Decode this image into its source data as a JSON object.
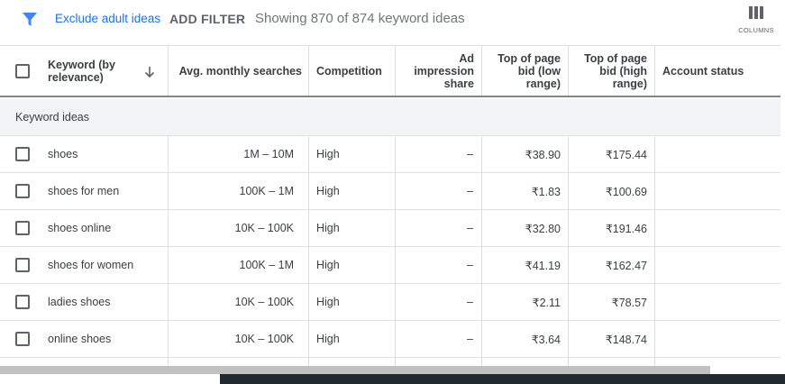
{
  "toolbar": {
    "filter_icon": "filter-funnel-icon",
    "exclude_label": "Exclude adult ideas",
    "add_filter_label": "ADD FILTER",
    "showing_text": "Showing 870 of 874 keyword ideas",
    "columns_label": "COLUMNS",
    "accent_color": "#1a73e8"
  },
  "table": {
    "headers": {
      "keyword_line1": "Keyword (by",
      "keyword_line2": "relevance)",
      "avg_searches": "Avg. monthly searches",
      "competition": "Competition",
      "ad_impression_line1": "Ad impression",
      "ad_impression_line2": "share",
      "bid_low_line1": "Top of page",
      "bid_low_line2": "bid (low",
      "bid_low_line3": "range)",
      "bid_high_line1": "Top of page",
      "bid_high_line2": "bid (high",
      "bid_high_line3": "range)",
      "account_status": "Account status"
    },
    "section_label": "Keyword ideas",
    "rows": [
      {
        "keyword": "shoes",
        "searches": "1M – 10M",
        "competition": "High",
        "impression": "–",
        "bid_low": "₹38.90",
        "bid_high": "₹175.44",
        "status": ""
      },
      {
        "keyword": "shoes for men",
        "searches": "100K – 1M",
        "competition": "High",
        "impression": "–",
        "bid_low": "₹1.83",
        "bid_high": "₹100.69",
        "status": ""
      },
      {
        "keyword": "shoes online",
        "searches": "10K – 100K",
        "competition": "High",
        "impression": "–",
        "bid_low": "₹32.80",
        "bid_high": "₹191.46",
        "status": ""
      },
      {
        "keyword": "shoes for women",
        "searches": "100K – 1M",
        "competition": "High",
        "impression": "–",
        "bid_low": "₹41.19",
        "bid_high": "₹162.47",
        "status": ""
      },
      {
        "keyword": "ladies shoes",
        "searches": "10K – 100K",
        "competition": "High",
        "impression": "–",
        "bid_low": "₹2.11",
        "bid_high": "₹78.57",
        "status": ""
      },
      {
        "keyword": "online shoes",
        "searches": "10K – 100K",
        "competition": "High",
        "impression": "–",
        "bid_low": "₹3.64",
        "bid_high": "₹148.74",
        "status": ""
      }
    ]
  }
}
